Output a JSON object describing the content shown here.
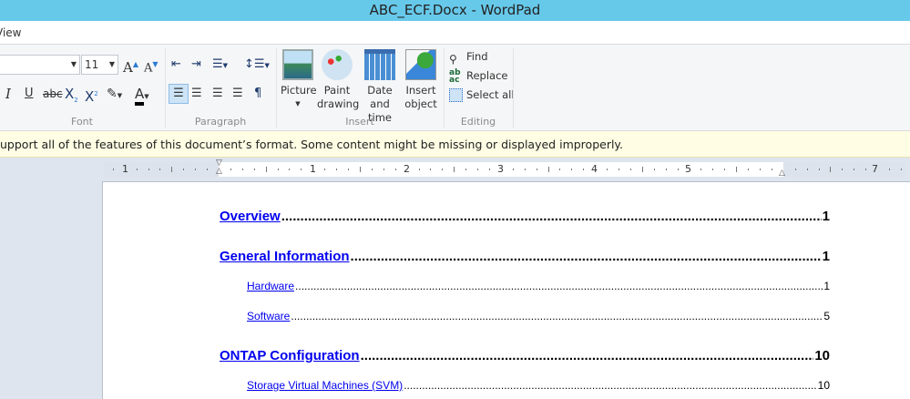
{
  "window": {
    "title": "ABC_ECF.Docx - WordPad"
  },
  "menu": {
    "view_tab": "View"
  },
  "ribbon": {
    "font": {
      "family_value": "",
      "size_value": "11",
      "group_label": "Font",
      "grow": "A",
      "shrink": "A",
      "italic": "I",
      "underline": "U",
      "strike": "abc",
      "subscript": "X",
      "superscript": "X",
      "font_color": "A"
    },
    "paragraph": {
      "group_label": "Paragraph"
    },
    "insert": {
      "group_label": "Insert",
      "picture": "Picture",
      "paint": "Paint drawing",
      "datetime": "Date and time",
      "object": "Insert object"
    },
    "editing": {
      "group_label": "Editing",
      "find": "Find",
      "replace": "Replace",
      "select_all": "Select all"
    }
  },
  "notice": "upport all of the features of this document’s format. Some content might be missing or displayed improperly.",
  "ruler": {
    "labels": [
      "1",
      "1",
      "2",
      "3",
      "4",
      "5",
      "7"
    ]
  },
  "toc": [
    {
      "title": "Overview",
      "page": "1",
      "level": 1
    },
    {
      "title": "General Information",
      "page": "1",
      "level": 1
    },
    {
      "title": "Hardware",
      "page": "1",
      "level": 2
    },
    {
      "title": "Software",
      "page": "5",
      "level": 2
    },
    {
      "title": "ONTAP Configuration",
      "page": "10",
      "level": 1
    },
    {
      "title": "Storage Virtual Machines (SVM)",
      "page": "10",
      "level": 2
    }
  ],
  "colors": {
    "titlebar": "#67c9ea",
    "link": "#0000ee",
    "notice_bg": "#fffde3"
  }
}
